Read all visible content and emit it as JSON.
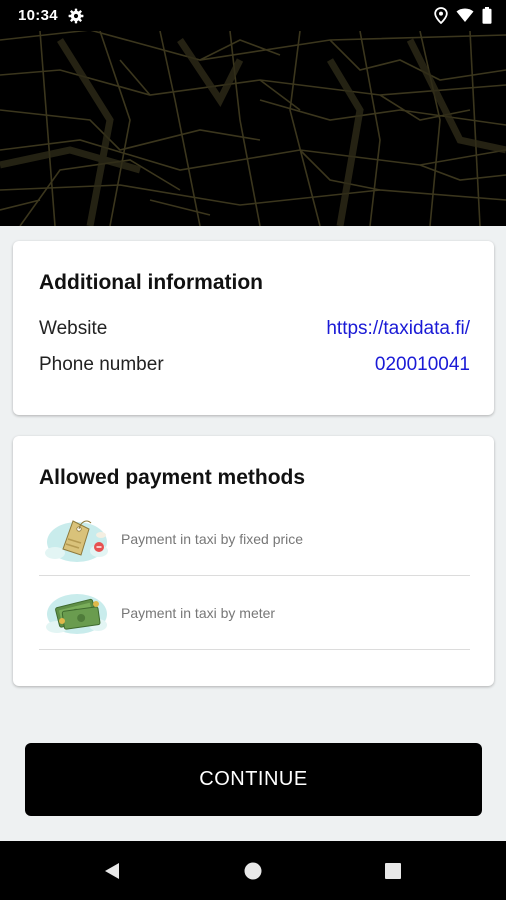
{
  "status_bar": {
    "time": "10:34",
    "icons": [
      "gear-icon",
      "location-icon",
      "wifi-icon",
      "battery-icon"
    ]
  },
  "additional_info": {
    "title": "Additional information",
    "website_label": "Website",
    "website_value": "https://taxidata.fi/",
    "phone_label": "Phone number",
    "phone_value": "020010041"
  },
  "payment": {
    "title": "Allowed payment methods",
    "items": [
      {
        "label": "Payment in taxi by fixed price",
        "icon": "price-tag-icon"
      },
      {
        "label": "Payment in taxi by meter",
        "icon": "banknotes-icon"
      }
    ]
  },
  "continue_label": "CONTINUE",
  "nav_bar": {
    "icons": [
      "back-icon",
      "home-icon",
      "recents-icon"
    ]
  },
  "colors": {
    "link": "#1a1ad6",
    "map_lines": "#3a351c",
    "background": "#eef1f2",
    "button": "#000000"
  }
}
